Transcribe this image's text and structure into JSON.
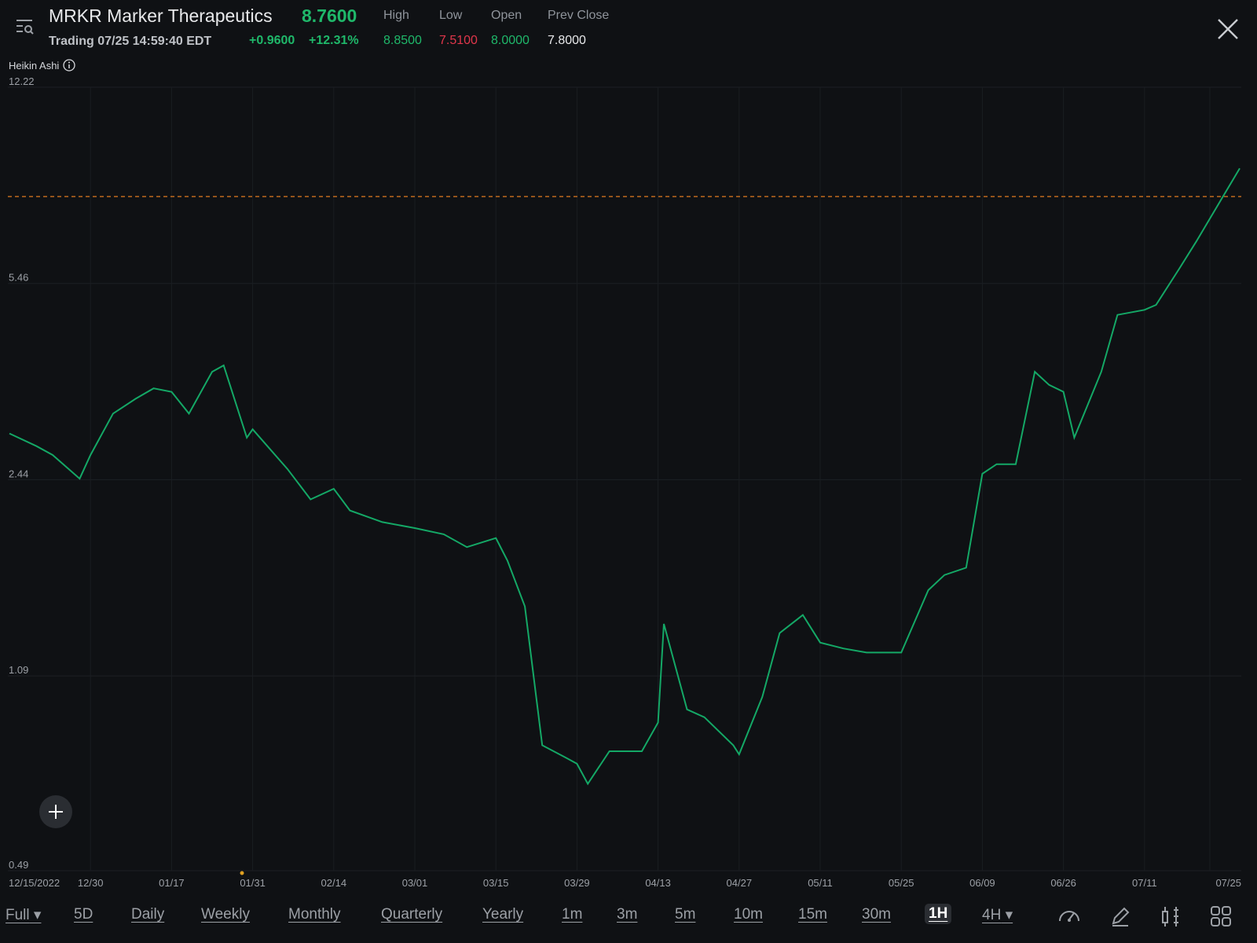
{
  "header": {
    "ticker_name": "MRKR Marker Therapeutics",
    "price": "8.7600",
    "status": "Trading 07/25 14:59:40 EDT",
    "change": "+0.9600",
    "change_pct": "+12.31%",
    "stats": {
      "high_label": "High",
      "high": "8.8500",
      "low_label": "Low",
      "low": "7.5100",
      "open_label": "Open",
      "open": "8.0000",
      "prev_close_label": "Prev Close",
      "prev_close": "7.8000"
    }
  },
  "indicator_label": "Heikin Ashi",
  "colors": {
    "up": "#1fb86a",
    "down": "#e0364b",
    "line": "#14a866",
    "reference": "#e07a1f",
    "background": "#0f1114"
  },
  "chart_data": {
    "type": "line",
    "y_scale": "log",
    "y_ticks": [
      "12.22",
      "5.46",
      "2.44",
      "1.09",
      "0.49"
    ],
    "ylim": [
      0.49,
      12.22
    ],
    "x_ticks": [
      "12/15/2022",
      "12/30",
      "01/17",
      "01/31",
      "02/14",
      "03/01",
      "03/15",
      "03/29",
      "04/13",
      "04/27",
      "05/11",
      "05/25",
      "06/09",
      "06/26",
      "07/11",
      "07/25"
    ],
    "reference_line": 7.8,
    "series": [
      {
        "x": [
          "12/15/2022",
          "12/20",
          "12/23",
          "12/28",
          "12/30",
          "01/04",
          "01/09",
          "01/13",
          "01/17",
          "01/20",
          "01/24",
          "01/26",
          "01/30",
          "01/31",
          "02/06",
          "02/10",
          "02/14",
          "02/17",
          "02/23",
          "03/01",
          "03/06",
          "03/10",
          "03/15",
          "03/17",
          "03/20",
          "03/23",
          "03/27",
          "03/29",
          "03/31",
          "04/04",
          "04/10",
          "04/13",
          "04/14",
          "04/18",
          "04/21",
          "04/26",
          "04/27",
          "05/01",
          "05/04",
          "05/08",
          "05/11",
          "05/15",
          "05/19",
          "05/25",
          "05/30",
          "06/02",
          "06/06",
          "06/09",
          "06/12",
          "06/16",
          "06/20",
          "06/23",
          "06/26",
          "06/28",
          "07/03",
          "07/06",
          "07/11",
          "07/13",
          "07/17",
          "07/20",
          "07/25"
        ],
        "values": [
          2.95,
          2.8,
          2.7,
          2.45,
          2.7,
          3.2,
          3.4,
          3.55,
          3.5,
          3.2,
          3.8,
          3.9,
          2.9,
          3.0,
          2.55,
          2.25,
          2.35,
          2.15,
          2.05,
          2.0,
          1.95,
          1.85,
          1.92,
          1.75,
          1.45,
          0.82,
          0.78,
          0.76,
          0.7,
          0.8,
          0.8,
          0.9,
          1.35,
          0.95,
          0.92,
          0.82,
          0.79,
          1.0,
          1.3,
          1.4,
          1.25,
          1.22,
          1.2,
          1.2,
          1.55,
          1.65,
          1.7,
          2.5,
          2.6,
          2.6,
          3.8,
          3.6,
          3.5,
          2.9,
          3.8,
          4.8,
          4.9,
          5.0,
          5.8,
          6.5,
          8.76
        ]
      }
    ]
  },
  "timeframes": {
    "full": "Full",
    "d5": "5D",
    "daily": "Daily",
    "weekly": "Weekly",
    "monthly": "Monthly",
    "quarterly": "Quarterly",
    "yearly": "Yearly",
    "m1": "1m",
    "m3": "3m",
    "m5": "5m",
    "m10": "10m",
    "m15": "15m",
    "m30": "30m",
    "h1": "1H",
    "h4": "4H"
  }
}
